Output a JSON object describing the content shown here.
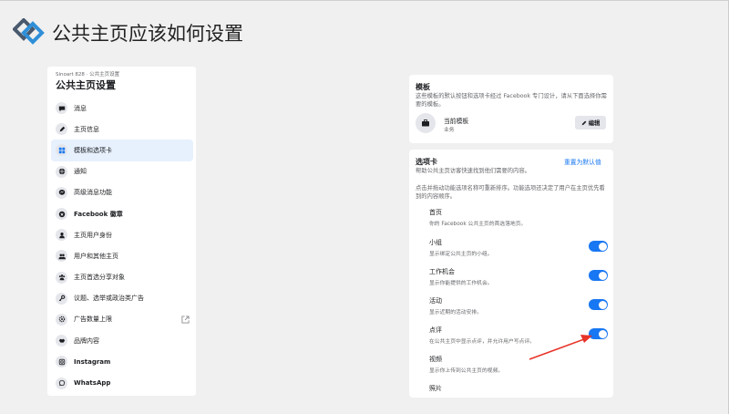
{
  "header": {
    "title": "公共主页应该如何设置"
  },
  "left_panel": {
    "crumb": "Sinoart 828 · 公共主页设置",
    "title": "公共主页设置",
    "items": [
      {
        "label": "消息",
        "icon": "chat-icon"
      },
      {
        "label": "主页信息",
        "icon": "pencil-icon"
      },
      {
        "label": "模板和选项卡",
        "icon": "grid-icon",
        "active": true
      },
      {
        "label": "通知",
        "icon": "globe-icon"
      },
      {
        "label": "高级消息功能",
        "icon": "messenger-icon"
      },
      {
        "label": "Facebook 徽章",
        "icon": "star-icon"
      },
      {
        "label": "主页用户身份",
        "icon": "user-icon"
      },
      {
        "label": "用户和其他主页",
        "icon": "users-icon"
      },
      {
        "label": "主页首选分享对象",
        "icon": "group-icon"
      },
      {
        "label": "议题、选举或政治类广告",
        "icon": "key-icon"
      },
      {
        "label": "广告数量上限",
        "icon": "gear-icon"
      },
      {
        "label": "品牌内容",
        "icon": "handshake-icon"
      },
      {
        "label": "Instagram",
        "icon": "instagram-icon"
      },
      {
        "label": "WhatsApp",
        "icon": "whatsapp-icon"
      }
    ]
  },
  "template_card": {
    "heading": "模板",
    "desc": "这些模板的默认按钮和选项卡经过 Facebook 专门设计，请从下面选择你需要的模板。",
    "current_name": "当前模板",
    "current_sub": "业务",
    "edit_label": "编辑"
  },
  "tabs_card": {
    "heading": "选项卡",
    "reset_label": "重置为默认值",
    "desc1": "帮助公共主页访客快速找到他们需要的内容。",
    "desc2": "点击并拖动功能选项名称可重新排序。功能选项还决定了用户在主页优先看到的内容顺序。",
    "tabs": [
      {
        "name": "首页",
        "desc": "你的 Facebook 公共主页的首选落地页。",
        "toggle": false
      },
      {
        "name": "小组",
        "desc": "显示绑定公共主页的小组。",
        "toggle": true
      },
      {
        "name": "工作机会",
        "desc": "显示你能提供的工作机会。",
        "toggle": true
      },
      {
        "name": "活动",
        "desc": "显示近期的活动安排。",
        "toggle": true
      },
      {
        "name": "点评",
        "desc": "在公共主页中显示点评，并允许用户写点评。",
        "toggle": true
      },
      {
        "name": "视频",
        "desc": "显示你上传到公共主页的视频。",
        "toggle": false
      },
      {
        "name": "照片",
        "desc": "",
        "toggle": false
      }
    ]
  },
  "colors": {
    "accent": "#1877f2",
    "arrow": "#e8342a"
  }
}
